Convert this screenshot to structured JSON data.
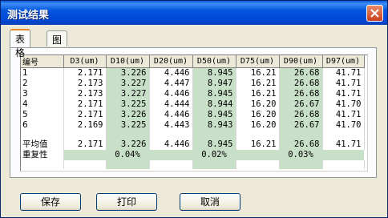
{
  "window": {
    "title": "测试结果"
  },
  "tabs": [
    {
      "label": "表格",
      "active": true
    },
    {
      "label": "图形",
      "active": false
    }
  ],
  "table": {
    "headers": [
      "编号",
      "D3(um)",
      "D10(um)",
      "D20(um)",
      "D50(um)",
      "D75(um)",
      "D90(um)",
      "D97(um)"
    ],
    "rows": [
      [
        "1",
        "2.171",
        "3.226",
        "4.446",
        "8.945",
        "16.21",
        "26.68",
        "41.71"
      ],
      [
        "2",
        "2.173",
        "3.227",
        "4.447",
        "8.947",
        "16.21",
        "26.68",
        "41.71"
      ],
      [
        "3",
        "2.173",
        "3.227",
        "4.446",
        "8.945",
        "16.21",
        "26.68",
        "41.71"
      ],
      [
        "4",
        "2.171",
        "3.225",
        "4.444",
        "8.944",
        "16.20",
        "26.67",
        "41.70"
      ],
      [
        "5",
        "2.171",
        "3.226",
        "4.446",
        "8.945",
        "16.20",
        "26.68",
        "41.71"
      ],
      [
        "6",
        "2.169",
        "3.225",
        "4.443",
        "8.943",
        "16.20",
        "26.67",
        "41.70"
      ]
    ],
    "average": [
      "平均值",
      "2.171",
      "3.226",
      "4.446",
      "8.945",
      "16.21",
      "26.68",
      "41.71"
    ],
    "repeatability": [
      "重复性",
      "",
      "0.04%",
      "",
      "0.02%",
      "",
      "0.03%",
      ""
    ],
    "highlight_color": "#c8dfc8"
  },
  "buttons": {
    "save": "保存",
    "print": "打印",
    "cancel": "取消"
  },
  "colors": {
    "titlebar": "#0455dd",
    "close": "#c8401e",
    "face": "#ece9d8"
  }
}
